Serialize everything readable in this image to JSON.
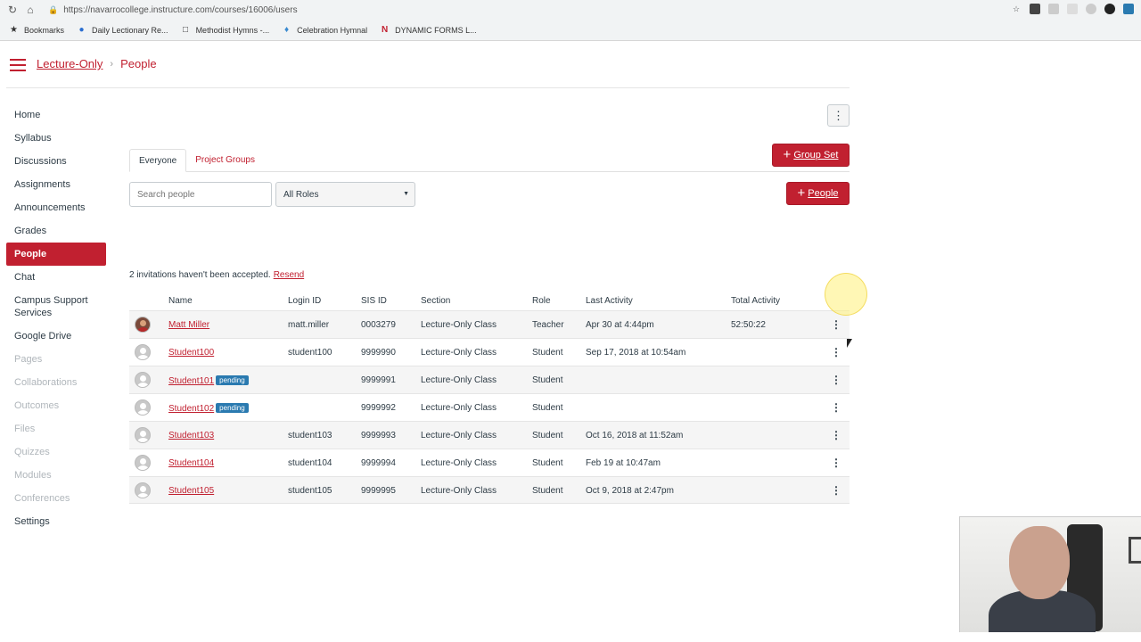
{
  "browser": {
    "url": "https://navarrocollege.instructure.com/courses/16006/users",
    "bookmarks": [
      "Bookmarks",
      "Daily Lectionary Re...",
      "Methodist Hymns -...",
      "Celebration Hymnal",
      "DYNAMIC FORMS L..."
    ]
  },
  "breadcrumb": {
    "course": "Lecture-Only",
    "current": "People"
  },
  "sidebar": {
    "items": [
      {
        "label": "Home",
        "state": "normal"
      },
      {
        "label": "Syllabus",
        "state": "normal"
      },
      {
        "label": "Discussions",
        "state": "normal"
      },
      {
        "label": "Assignments",
        "state": "normal"
      },
      {
        "label": "Announcements",
        "state": "normal"
      },
      {
        "label": "Grades",
        "state": "normal"
      },
      {
        "label": "People",
        "state": "active"
      },
      {
        "label": "Chat",
        "state": "normal"
      },
      {
        "label": "Campus Support Services",
        "state": "normal"
      },
      {
        "label": "Google Drive",
        "state": "normal"
      },
      {
        "label": "Pages",
        "state": "disabled"
      },
      {
        "label": "Collaborations",
        "state": "disabled"
      },
      {
        "label": "Outcomes",
        "state": "disabled"
      },
      {
        "label": "Files",
        "state": "disabled"
      },
      {
        "label": "Quizzes",
        "state": "disabled"
      },
      {
        "label": "Modules",
        "state": "disabled"
      },
      {
        "label": "Conferences",
        "state": "disabled"
      },
      {
        "label": "Settings",
        "state": "normal"
      }
    ]
  },
  "tabs": [
    "Everyone",
    "Project Groups"
  ],
  "buttons": {
    "group_set": "Group Set",
    "people": "People",
    "plus": "+"
  },
  "search": {
    "placeholder": "Search people"
  },
  "roles_select": {
    "value": "All Roles"
  },
  "invitations": {
    "text": "2 invitations haven't been accepted.",
    "resend": "Resend"
  },
  "table": {
    "headers": [
      "Name",
      "Login ID",
      "SIS ID",
      "Section",
      "Role",
      "Last Activity",
      "Total Activity"
    ],
    "rows": [
      {
        "name": "Matt Miller",
        "pending": "",
        "login": "matt.miller",
        "sis": "0003279",
        "section": "Lecture-Only Class",
        "role": "Teacher",
        "last": "Apr 30 at 4:44pm",
        "total": "52:50:22",
        "photo": true
      },
      {
        "name": "Student100",
        "pending": "",
        "login": "student100",
        "sis": "9999990",
        "section": "Lecture-Only Class",
        "role": "Student",
        "last": "Sep 17, 2018 at 10:54am",
        "total": ""
      },
      {
        "name": "Student101",
        "pending": "pending",
        "login": "",
        "sis": "9999991",
        "section": "Lecture-Only Class",
        "role": "Student",
        "last": "",
        "total": ""
      },
      {
        "name": "Student102",
        "pending": "pending",
        "login": "",
        "sis": "9999992",
        "section": "Lecture-Only Class",
        "role": "Student",
        "last": "",
        "total": ""
      },
      {
        "name": "Student103",
        "pending": "",
        "login": "student103",
        "sis": "9999993",
        "section": "Lecture-Only Class",
        "role": "Student",
        "last": "Oct 16, 2018 at 11:52am",
        "total": ""
      },
      {
        "name": "Student104",
        "pending": "",
        "login": "student104",
        "sis": "9999994",
        "section": "Lecture-Only Class",
        "role": "Student",
        "last": "Feb 19 at 10:47am",
        "total": ""
      },
      {
        "name": "Student105",
        "pending": "",
        "login": "student105",
        "sis": "9999995",
        "section": "Lecture-Only Class",
        "role": "Student",
        "last": "Oct 9, 2018 at 2:47pm",
        "total": ""
      }
    ]
  },
  "colors": {
    "accent": "#c12030",
    "pending_badge": "#2a7ab0",
    "text": "#2d3b45"
  }
}
